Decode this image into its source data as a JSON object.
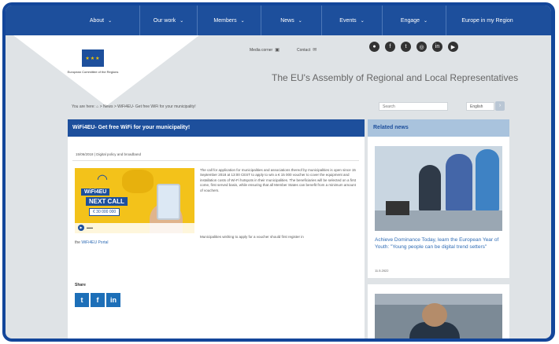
{
  "nav": {
    "items": [
      {
        "label": "About",
        "chev": "⌄"
      },
      {
        "label": "Our work",
        "chev": "⌄"
      },
      {
        "label": "Members",
        "chev": "⌄"
      },
      {
        "label": "News",
        "chev": "⌄"
      },
      {
        "label": "Events",
        "chev": "⌄"
      },
      {
        "label": "Engage",
        "chev": "⌄"
      },
      {
        "label": "Europe in my Region",
        "chev": ""
      }
    ]
  },
  "header": {
    "logo_text": "European Committee of the Regions",
    "media_corner": "Media corner",
    "contact": "Contact",
    "tagline": "The EU's Assembly of Regional and Local Representatives",
    "social_icons": [
      "flickr-icon",
      "facebook-icon",
      "twitter-icon",
      "instagram-icon",
      "linkedin-icon",
      "youtube-icon"
    ]
  },
  "breadcrumb": {
    "text": "You are here: ⌂ > News > WiFi4EU- Get free WiFi for your municipality!"
  },
  "search": {
    "placeholder": "Search"
  },
  "language": {
    "value": "English"
  },
  "article": {
    "title": "WiFi4EU- Get free WiFi for your municipality!",
    "meta": "15/06/2018 | Digital policy and broadband",
    "promo_lines": [
      "WiFi4EU",
      "NEXT CALL",
      "€ 30 000 000"
    ],
    "body": "The call for application for municipalities and associations thereof by municipalities is open since 15 September 2018 at 13:00 CEST to apply to win a € 15 000 voucher to cover the equipment and installation costs of Wi-Fi hotspots in their municipalities. The beneficiaries will be selected on a first come, first served basis, while ensuring that all Member States can benefit from a minimum amount of vouchers.",
    "body2": "Municipalities wishing to apply for a voucher should first register in",
    "link_prefix": "the",
    "link_text": "WiFi4EU Portal",
    "share_label": "Share"
  },
  "sidebar": {
    "heading": "Related news",
    "news1_title": "Achieve Dominance Today, learn the European Year of Youth: \"Young people can be digital trend setters\"",
    "news1_date": "11.5.2022"
  },
  "colors": {
    "brand": "#1d4f9c",
    "frame": "#13469a",
    "accent": "#f3c21a"
  }
}
